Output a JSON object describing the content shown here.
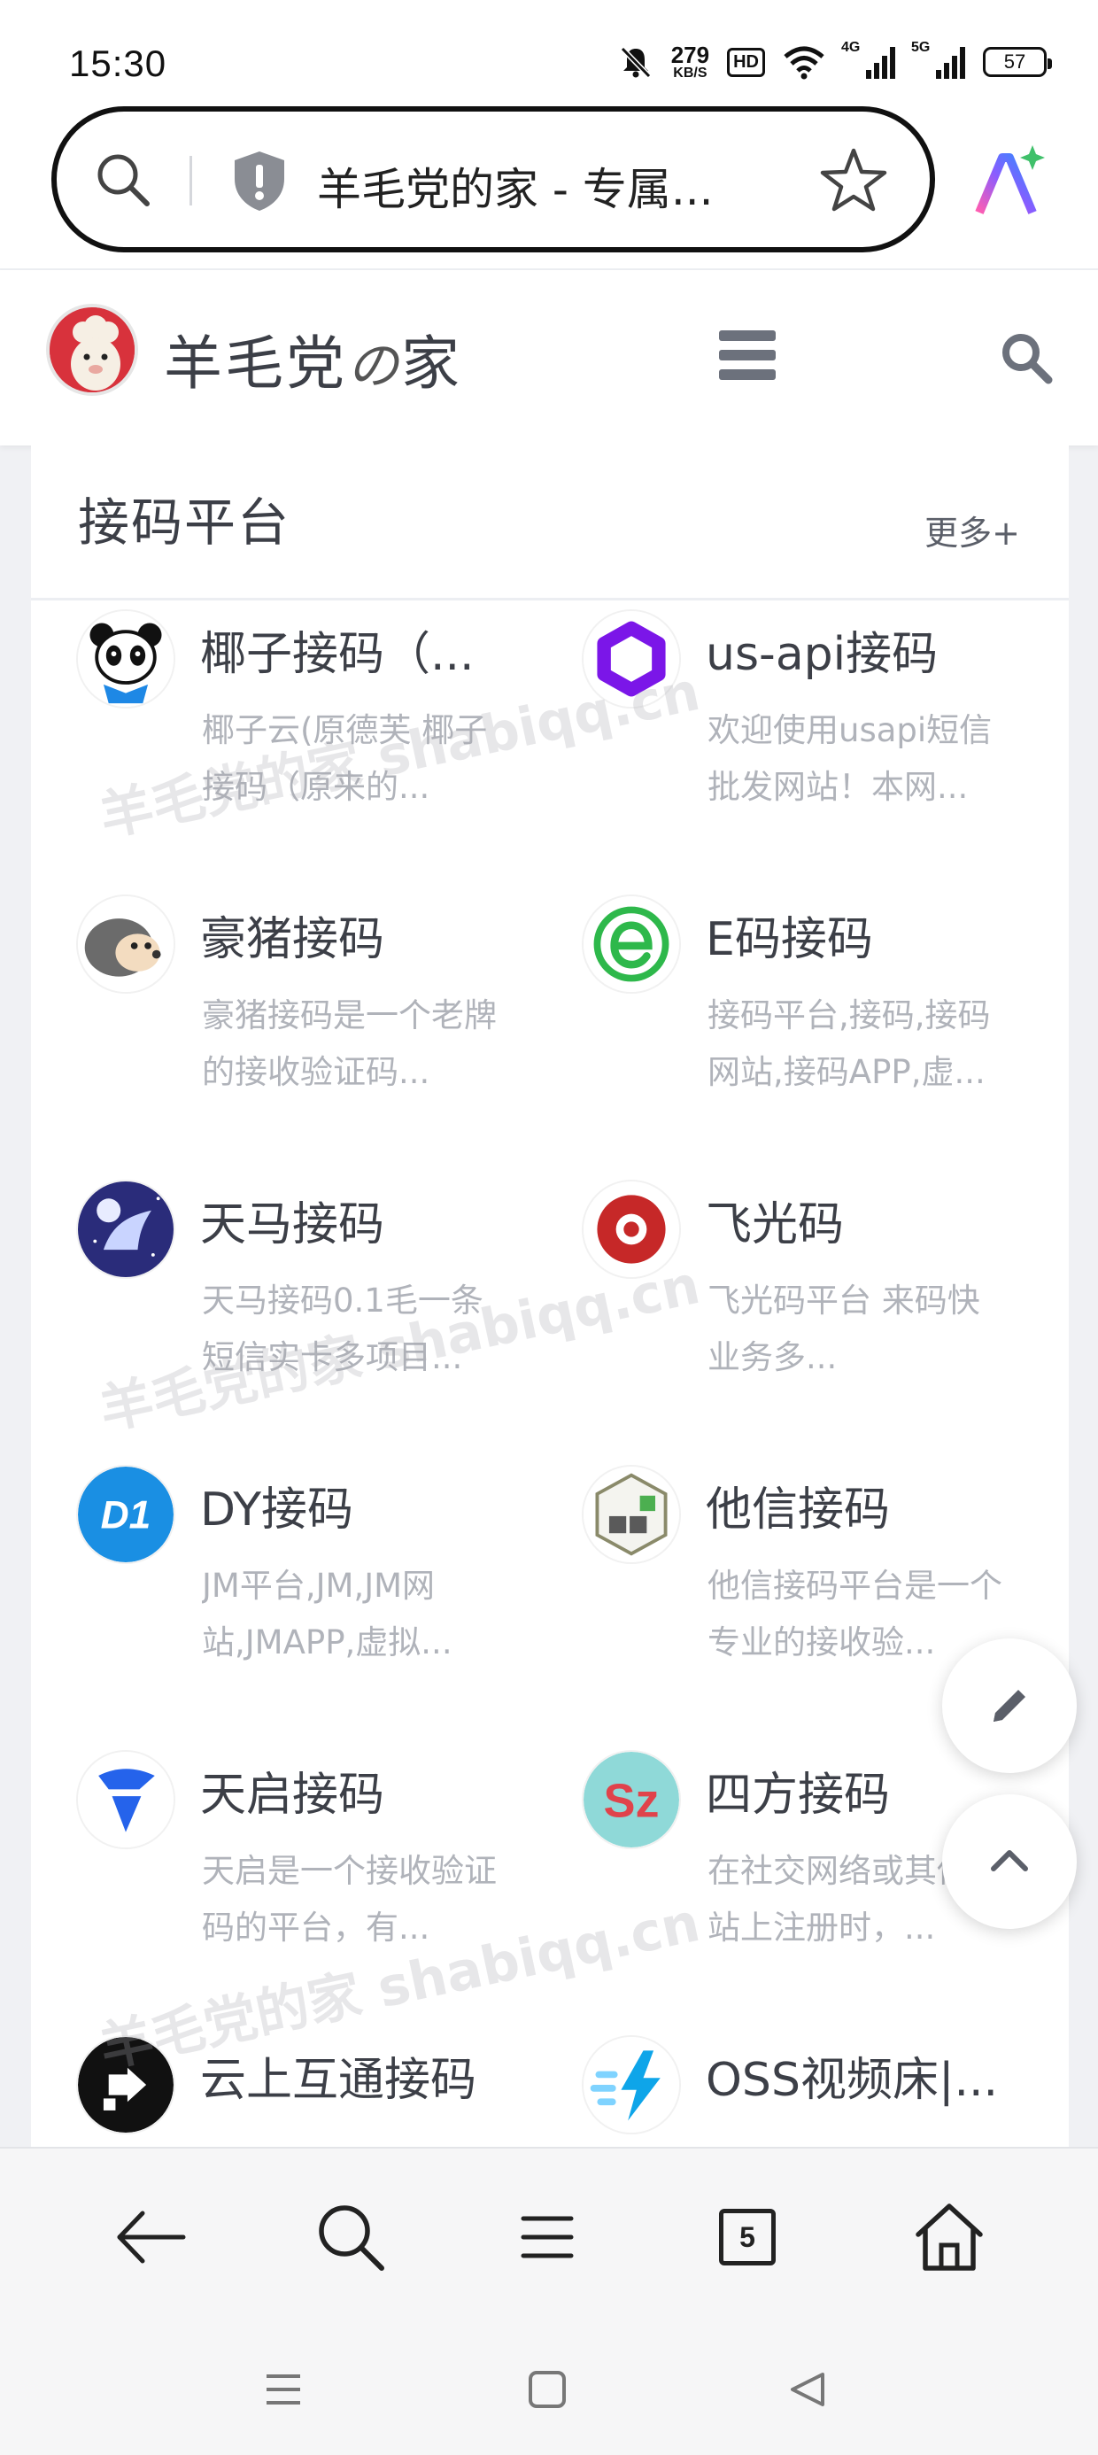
{
  "status_bar": {
    "time": "15:30",
    "net_speed_value": "279",
    "net_speed_unit": "KB/S",
    "hd_label": "HD",
    "signal_1_label": "4G",
    "signal_2_label": "5G",
    "battery": "57",
    "icons": [
      "mute-bell-icon",
      "wifi-icon",
      "signal-icon",
      "battery-icon"
    ]
  },
  "address_bar": {
    "title": "羊毛党的家 - 专属...",
    "icons": [
      "search-icon",
      "shield-icon",
      "star-icon",
      "ai-assistant-icon"
    ]
  },
  "site_header": {
    "site_name_part1": "羊毛党",
    "site_name_no": "の",
    "site_name_part2": "家",
    "icons": [
      "alpaca-logo",
      "hamburger-menu-icon",
      "search-icon"
    ]
  },
  "section": {
    "title": "接码平台",
    "more_label": "更多+"
  },
  "items": [
    {
      "title": "椰子接码（...",
      "desc": "椰子云(原德芙 椰子接码（原来的...",
      "icon": "panda-icon"
    },
    {
      "title": "us-api接码",
      "desc": "欢迎使用usapi短信批发网站！本网...",
      "icon": "purple-hexagon-icon"
    },
    {
      "title": "豪猪接码",
      "desc": "豪猪接码是一个老牌的接收验证码...",
      "icon": "hedgehog-icon"
    },
    {
      "title": "E码接码",
      "desc": "接码平台,接码,接码网站,接码APP,虚...",
      "icon": "green-e-icon"
    },
    {
      "title": "天马接码",
      "desc": "天马接码0.1毛一条短信实卡多项目...",
      "icon": "pegasus-icon"
    },
    {
      "title": "飞光码",
      "desc": "飞光码平台 来码快业务多...",
      "icon": "red-target-icon"
    },
    {
      "title": "DY接码",
      "desc": "JM平台,JM,JM网站,JMAPP,虚拟...",
      "icon": "dy-logo-icon"
    },
    {
      "title": "他信接码",
      "desc": "他信接码平台是一个专业的接收验...",
      "icon": "hex-cube-icon"
    },
    {
      "title": "天启接码",
      "desc": "天启是一个接收验证码的平台，有...",
      "icon": "blue-shield-icon"
    },
    {
      "title": "四方接码",
      "desc": "在社交网络或其他网站上注册时，...",
      "icon": "sz-logo-icon"
    },
    {
      "title": "云上互通接码",
      "desc": "",
      "icon": "black-arrow-icon"
    },
    {
      "title": "OSS视频床|...",
      "desc": "",
      "icon": "lightning-icon"
    }
  ],
  "watermark": "羊毛党的家 shabiqq.cn",
  "floating": [
    "edit-pencil-icon",
    "scroll-top-icon"
  ],
  "browser_nav": {
    "tab_count": "5",
    "icons": [
      "back-arrow-icon",
      "search-icon",
      "menu-icon",
      "tabs-icon",
      "home-icon"
    ]
  },
  "system_nav": {
    "icons": [
      "recent-apps-icon",
      "home-square-icon",
      "back-triangle-icon"
    ]
  }
}
